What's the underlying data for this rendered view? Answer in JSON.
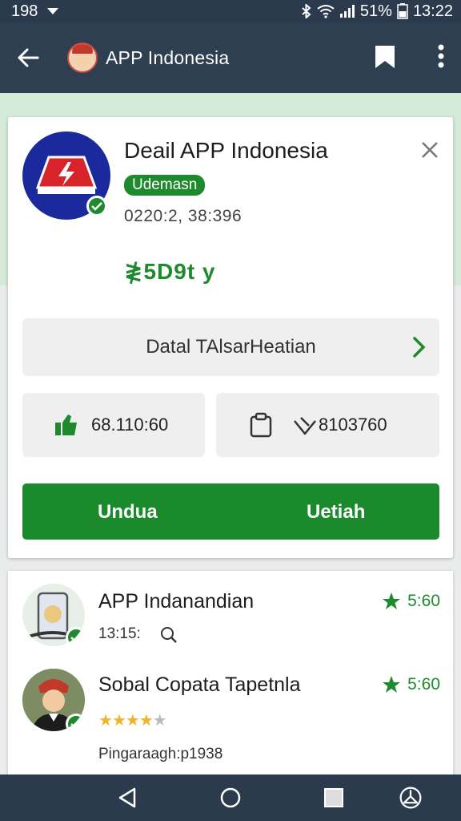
{
  "status_bar": {
    "left_text": "198",
    "battery_text": "51%",
    "time": "13:22"
  },
  "app_bar": {
    "title": "APP Indonesia",
    "icons": [
      "back-arrow-icon",
      "bookmark-icon",
      "more-vert-icon"
    ]
  },
  "detail_card": {
    "app_name": "Deail APP Indonesia",
    "badge": "Udemasn",
    "date": "0220:2, 38:396",
    "price": "≹5D9t y",
    "detail_link": "Datal TAlsarHeatian",
    "stat_left": "68.110:60",
    "stat_right": "8103760",
    "action_left": "Undua",
    "action_right": "Uetiah",
    "colors": {
      "accent": "#1e8a2e",
      "logo_bg": "#1a2a9c",
      "logo_red": "#d8232a"
    }
  },
  "list": [
    {
      "title": "APP Indanandian",
      "subtitle": "13:15:",
      "rating": "5:60"
    },
    {
      "title": "Sobal Copata Tapetnla",
      "rating": "5:60",
      "stars_on": 4,
      "stars_total": 5,
      "footer": "Pingaraagh:p1938"
    }
  ],
  "nav": [
    "back-triangle-icon",
    "home-circle-icon",
    "recents-square-icon",
    "assistant-icon"
  ]
}
